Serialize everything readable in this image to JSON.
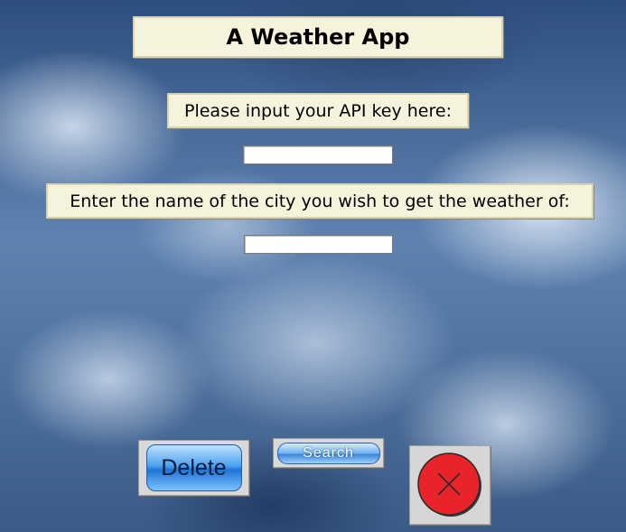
{
  "app": {
    "title": "A Weather App"
  },
  "form": {
    "api_label": "Please input your API key here:",
    "api_value": "",
    "city_label": "Enter the name of the city you wish to get the weather of:",
    "city_value": ""
  },
  "buttons": {
    "delete_label": "Delete",
    "search_label": "Search",
    "close_icon": "close-icon"
  },
  "colors": {
    "label_bg": "#f6f3dc",
    "button_blue": "#1f74d6",
    "close_red": "#e8232a"
  }
}
